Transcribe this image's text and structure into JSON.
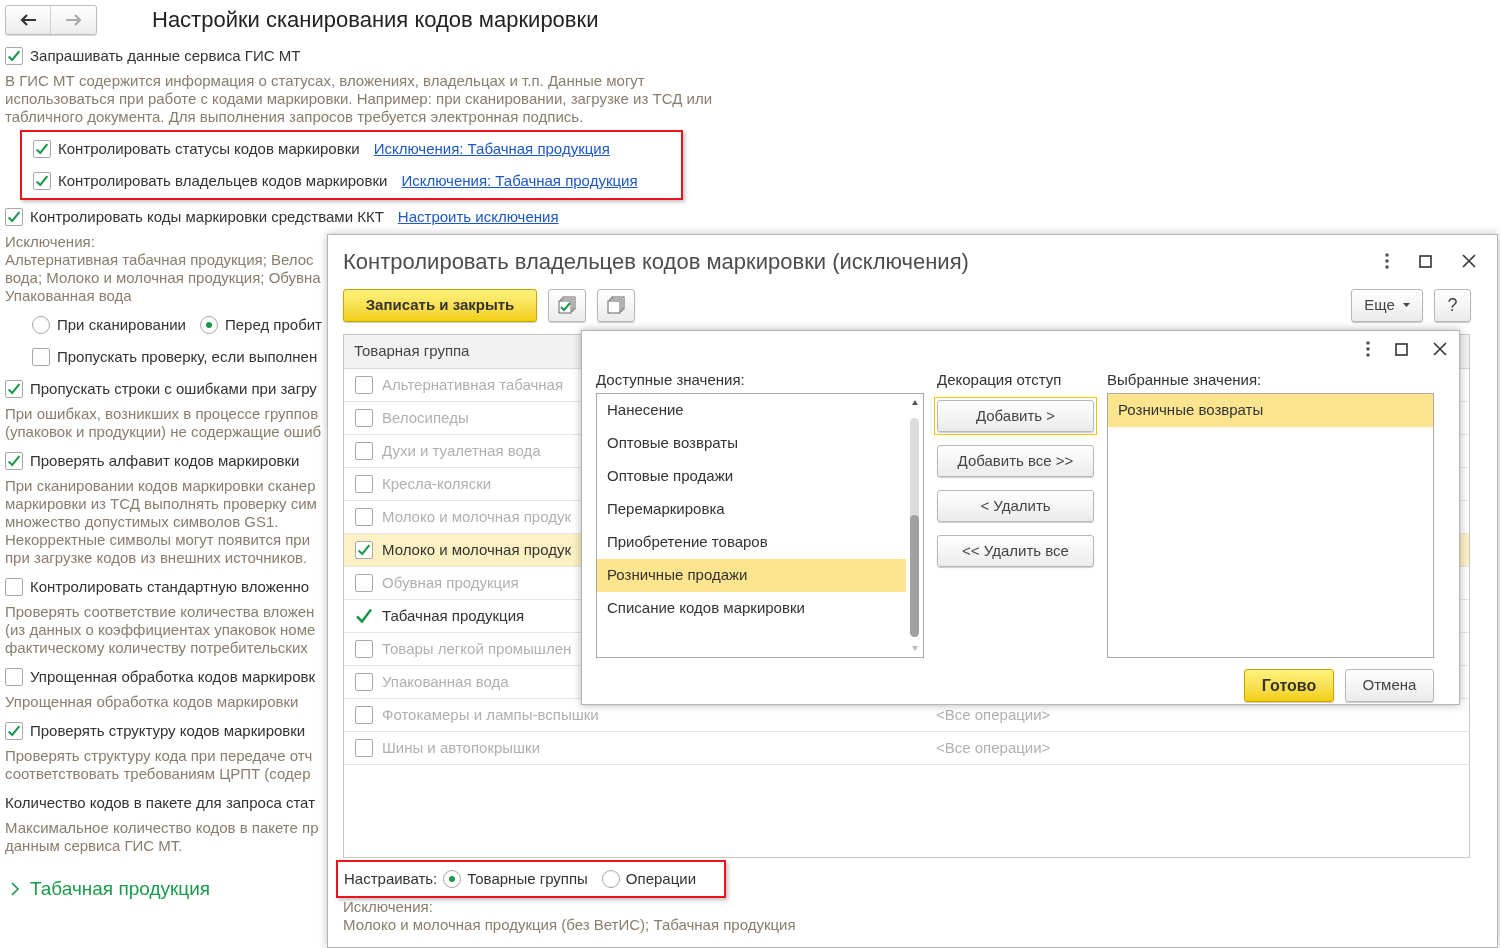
{
  "title": "Настройки сканирования кодов маркировки",
  "settings": [
    {
      "kind": "checkbox",
      "label": "Запрашивать данные сервиса ГИС МТ",
      "checked": true
    },
    {
      "kind": "note",
      "lines": [
        "В ГИС МТ содержится информация о статусах, вложениях, владельцах и т.п. Данные могут",
        "использоваться при работе с кодами маркировки. Например: при сканировании, загрузке из ТСД или",
        "табличного документа. Для выполнения запросов требуется электронная подпись."
      ]
    },
    {
      "kind": "framed",
      "items": [
        {
          "kind": "checkbox",
          "label": "Контролировать статусы кодов маркировки",
          "checked": true,
          "link": "Исключения: Табачная продукция"
        },
        {
          "kind": "checkbox",
          "label": "Контролировать владельцев кодов маркировки",
          "checked": true,
          "link": "Исключения: Табачная продукция"
        }
      ]
    },
    {
      "kind": "checkbox",
      "label": "Контролировать коды маркировки средствами ККТ",
      "checked": true,
      "link": "Настроить исключения"
    },
    {
      "kind": "note",
      "lines": [
        "Исключения:",
        "Альтернативная табачная продукция; Велос",
        "вода; Молоко и молочная продукция; Обувна",
        "Упакованная вода"
      ]
    },
    {
      "kind": "indent",
      "items": [
        {
          "kind": "radios",
          "options": [
            {
              "label": "При сканировании",
              "selected": false
            },
            {
              "label": "Перед пробит",
              "selected": true
            }
          ]
        },
        {
          "kind": "checkbox",
          "label": "Пропускать проверку, если выполнен",
          "checked": false
        }
      ]
    },
    {
      "kind": "checkbox",
      "label": "Пропускать строки с ошибками при загру",
      "checked": true
    },
    {
      "kind": "note",
      "lines": [
        "При ошибках, возникших в процессе группов",
        "(упаковок и продукции) не содержащие ошиб"
      ]
    },
    {
      "kind": "checkbox",
      "label": "Проверять алфавит кодов маркировки",
      "checked": true
    },
    {
      "kind": "note",
      "lines": [
        "При сканировании кодов маркировки сканер",
        "маркировки из ТСД выполнять проверку сим",
        "множество допустимых символов GS1.",
        "Некорректные символы могут появится при",
        "при загрузке кодов из внешних источников."
      ]
    },
    {
      "kind": "checkbox",
      "label": "Контролировать стандартную вложенно",
      "checked": false
    },
    {
      "kind": "note",
      "lines": [
        "Проверять соответствие количества вложен",
        "(из данных о коэффициентах упаковок номе",
        "фактическому количеству потребительских"
      ]
    },
    {
      "kind": "checkbox",
      "label": "Упрощенная обработка кодов маркировк",
      "checked": false
    },
    {
      "kind": "note",
      "lines": [
        "Упрощенная обработка кодов маркировки"
      ]
    },
    {
      "kind": "checkbox",
      "label": "Проверять структуру кодов маркировки",
      "checked": true
    },
    {
      "kind": "note",
      "lines": [
        "Проверять структуру кода при передаче отч",
        "соответствовать требованиям ЦРПТ (содер"
      ]
    },
    {
      "kind": "label",
      "text": "Количество кодов в пакете для запроса стат"
    },
    {
      "kind": "note",
      "lines": [
        "Максимальное количество кодов в пакете пр",
        "данным сервиса ГИС МТ."
      ]
    }
  ],
  "section": {
    "label": "Табачная продукция",
    "expanded": false
  },
  "dialog": {
    "title": "Контролировать владельцев кодов маркировки (исключения)",
    "save_button": "Записать и закрыть",
    "more_button": "Еще",
    "help_button": "?",
    "table": {
      "columns": [
        "Товарная группа"
      ],
      "rows": [
        {
          "kind": "checkbox",
          "name": "Альтернативная табачная",
          "checked": false,
          "selected": false
        },
        {
          "kind": "checkbox",
          "name": "Велосипеды",
          "checked": false,
          "selected": false
        },
        {
          "kind": "checkbox",
          "name": "Духи и туалетная вода",
          "checked": false,
          "selected": false
        },
        {
          "kind": "checkbox",
          "name": "Кресла-коляски",
          "checked": false,
          "selected": false
        },
        {
          "kind": "checkbox",
          "name": "Молоко и молочная продук",
          "checked": false,
          "selected": false
        },
        {
          "kind": "checkbox",
          "name": "Молоко и молочная продук",
          "checked": true,
          "selected": true
        },
        {
          "kind": "checkbox",
          "name": "Обувная продукция",
          "checked": false,
          "selected": false
        },
        {
          "kind": "mark",
          "name": "Табачная продукция",
          "checked": true,
          "selected": false
        },
        {
          "kind": "checkbox",
          "name": "Товары легкой промышлен",
          "checked": false,
          "selected": false
        },
        {
          "kind": "checkbox",
          "name": "Упакованная вода",
          "checked": false,
          "selected": false
        },
        {
          "kind": "checkbox",
          "name": "Фотокамеры и лампы-вспышки",
          "checked": false,
          "selected": false,
          "operations": "<Все операции>"
        },
        {
          "kind": "checkbox",
          "name": "Шины и автопокрышки",
          "checked": false,
          "selected": false,
          "operations": "<Все операции>"
        }
      ]
    },
    "setup": {
      "label": "Настраивать:",
      "options": [
        {
          "label": "Товарные группы",
          "selected": true
        },
        {
          "label": "Операции",
          "selected": false
        }
      ]
    },
    "exceptions": {
      "label": "Исключения:",
      "text": "Молоко и молочная продукция (без ВетИС); Табачная продукция"
    }
  },
  "picker": {
    "available_label": "Доступные значения:",
    "available": [
      {
        "label": "Нанесение",
        "selected": false
      },
      {
        "label": "Оптовые возвраты",
        "selected": false
      },
      {
        "label": "Оптовые продажи",
        "selected": false
      },
      {
        "label": "Перемаркировка",
        "selected": false
      },
      {
        "label": "Приобретение товаров",
        "selected": false
      },
      {
        "label": "Розничные продажи",
        "selected": true
      },
      {
        "label": "Списание кодов маркировки",
        "selected": false
      }
    ],
    "middle_label": "Декорация отступ",
    "buttons": [
      {
        "label": "Добавить >",
        "focused": true
      },
      {
        "label": "Добавить все >>",
        "focused": false
      },
      {
        "label": "< Удалить",
        "focused": false
      },
      {
        "label": "<< Удалить все",
        "focused": false
      }
    ],
    "chosen_label": "Выбранные значения:",
    "chosen": [
      {
        "label": "Розничные возвраты",
        "selected": true
      }
    ],
    "ok_button": "Готово",
    "cancel_button": "Отмена"
  }
}
